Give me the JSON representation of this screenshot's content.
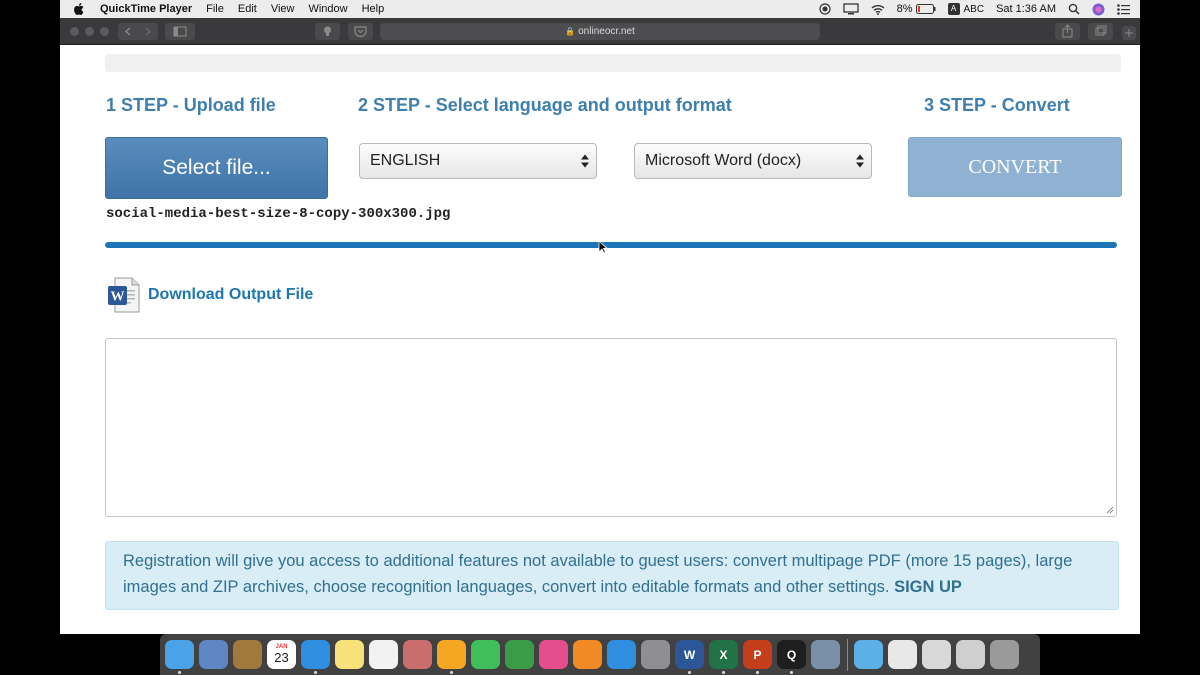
{
  "menubar": {
    "app_name": "QuickTime Player",
    "menus": [
      "File",
      "Edit",
      "View",
      "Window",
      "Help"
    ],
    "battery": "8%",
    "input_source": "ABC",
    "input_badge": "A",
    "clock": "Sat 1:36 AM"
  },
  "browser": {
    "url": "onlineocr.net"
  },
  "steps": {
    "step1": "1 STEP - Upload file",
    "step2": "2 STEP - Select language and output format",
    "step3": "3 STEP - Convert"
  },
  "upload": {
    "select_label": "Select file...",
    "filename": "social-media-best-size-8-copy-300x300.jpg",
    "progress": 1.0
  },
  "language_select": {
    "value": "ENGLISH"
  },
  "format_select": {
    "value": "Microsoft Word (docx)"
  },
  "convert_label": "CONVERT",
  "download": {
    "label": "Download Output File",
    "icon_letter": "W"
  },
  "result_text": "",
  "notice": {
    "text": "Registration will give you access to additional features not available to guest users: convert multipage PDF (more 15 pages), large images and ZIP archives, choose recognition languages, convert into editable formats and other settings.",
    "signup": "SIGN UP"
  },
  "dock": {
    "calendar_month": "JAN",
    "calendar_day": "23",
    "apps_left": [
      {
        "name": "finder",
        "color": "#4aa3e8"
      },
      {
        "name": "preview",
        "color": "#5d86c2"
      },
      {
        "name": "contacts",
        "color": "#a07a3c"
      },
      {
        "name": "calendar",
        "color": "#ffffff"
      },
      {
        "name": "safari",
        "color": "#2f8ee0"
      },
      {
        "name": "notes",
        "color": "#f7e27a"
      },
      {
        "name": "reminders",
        "color": "#f2f2f2"
      },
      {
        "name": "photo-booth",
        "color": "#c96d6d"
      },
      {
        "name": "photos",
        "color": "#f5a623"
      },
      {
        "name": "facetime",
        "color": "#3fbf5a"
      },
      {
        "name": "numbers",
        "color": "#3b9c48"
      },
      {
        "name": "itunes",
        "color": "#e34d8c"
      },
      {
        "name": "ibooks",
        "color": "#f08a24"
      },
      {
        "name": "app-store",
        "color": "#2f8ee0"
      },
      {
        "name": "system-preferences",
        "color": "#8e8e93"
      },
      {
        "name": "word",
        "color": "#2b5797",
        "letter": "W"
      },
      {
        "name": "excel",
        "color": "#217346",
        "letter": "X"
      },
      {
        "name": "powerpoint",
        "color": "#c43e1c",
        "letter": "P"
      },
      {
        "name": "quicktime",
        "color": "#1e1e1e",
        "letter": "Q"
      },
      {
        "name": "image-capture",
        "color": "#7a8fa8"
      }
    ],
    "apps_right": [
      {
        "name": "downloads-folder",
        "color": "#5bb0e8"
      },
      {
        "name": "document-stack",
        "color": "#e8e8e8"
      },
      {
        "name": "document-stack-2",
        "color": "#d8d8d8"
      },
      {
        "name": "screenshot-stack",
        "color": "#cfcfcf"
      },
      {
        "name": "trash",
        "color": "#9a9a9a"
      }
    ]
  }
}
